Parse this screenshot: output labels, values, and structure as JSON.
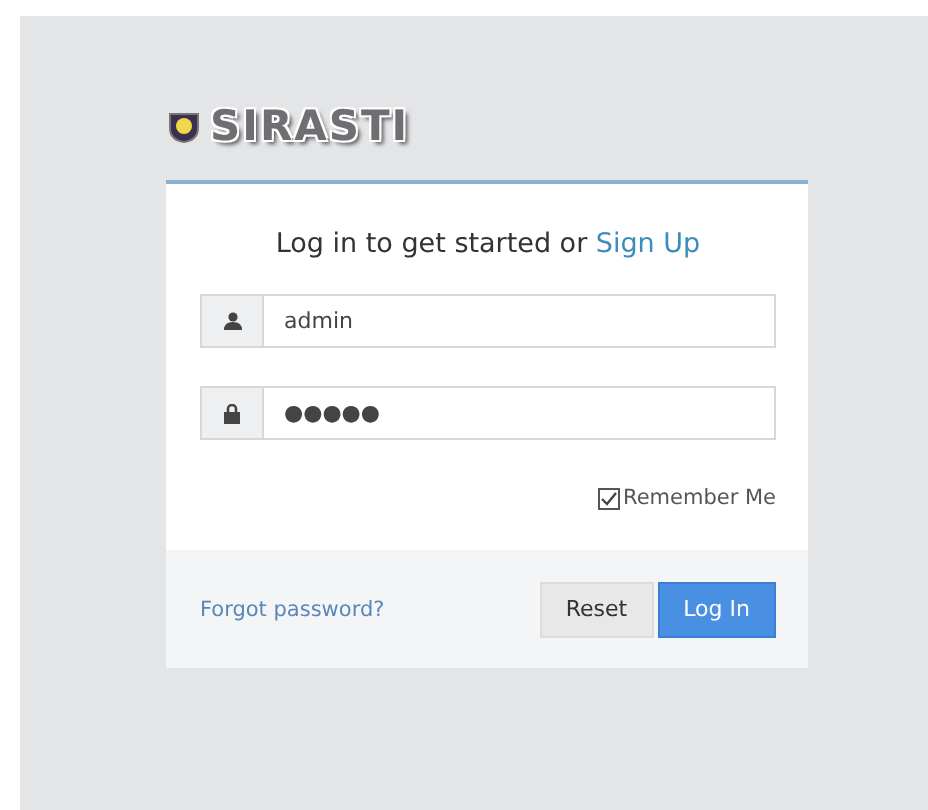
{
  "logo": {
    "text": "SIRASTI"
  },
  "login_box": {
    "heading": "Log in to get started or **Sign Up**",
    "fields": [
      {
        "kind": "user",
        "value": "admin"
      },
      {
        "kind": "password",
        "value": "●●●●●"
      }
    ],
    "remember_me": {
      "label": "Remember Me",
      "checked": true
    },
    "forgot_link": "Forgot password?",
    "buttons": [
      {
        "kind": "secondary",
        "label": "Reset"
      },
      {
        "kind": "primary",
        "label": "Log In"
      }
    ]
  }
}
